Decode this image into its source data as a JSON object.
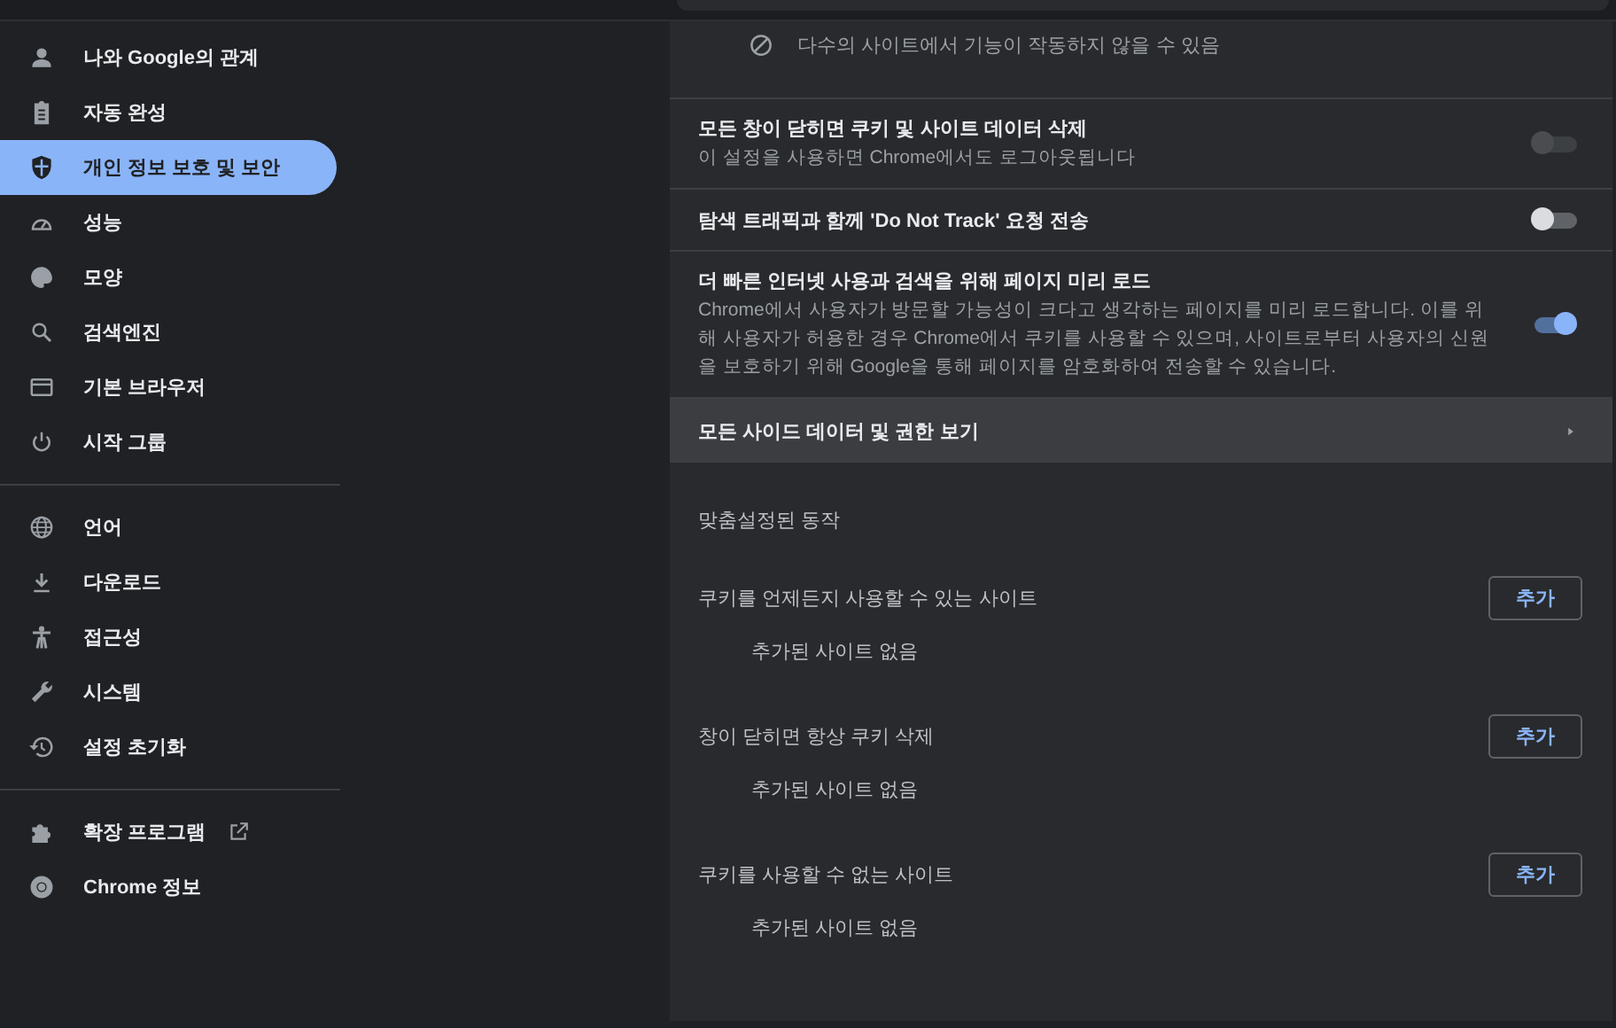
{
  "sidebar": {
    "groups": [
      [
        {
          "label": "나와 Google의 관계",
          "selected": false,
          "external": false
        },
        {
          "label": "자동 완성",
          "selected": false,
          "external": false
        },
        {
          "label": "개인 정보 보호 및 보안",
          "selected": true,
          "external": false
        },
        {
          "label": "성능",
          "selected": false,
          "external": false
        },
        {
          "label": "모양",
          "selected": false,
          "external": false
        },
        {
          "label": "검색엔진",
          "selected": false,
          "external": false
        },
        {
          "label": "기본 브라우저",
          "selected": false,
          "external": false
        },
        {
          "label": "시작 그룹",
          "selected": false,
          "external": false
        }
      ],
      [
        {
          "label": "언어",
          "selected": false,
          "external": false
        },
        {
          "label": "다운로드",
          "selected": false,
          "external": false
        },
        {
          "label": "접근성",
          "selected": false,
          "external": false
        },
        {
          "label": "시스템",
          "selected": false,
          "external": false
        },
        {
          "label": "설정 초기화",
          "selected": false,
          "external": false
        }
      ],
      [
        {
          "label": "확장 프로그램",
          "selected": false,
          "external": true
        },
        {
          "label": "Chrome 정보",
          "selected": false,
          "external": false
        }
      ]
    ]
  },
  "blocked_note": {
    "text": "다수의 사이트에서 기능이 작동하지 않을 수 있음"
  },
  "settings": [
    {
      "title": "모든 창이 닫히면 쿠키 및 사이트 데이터 삭제",
      "description": "이 설정을 사용하면 Chrome에서도 로그아웃됩니다",
      "on": false,
      "disabled": true
    },
    {
      "title": "탐색 트래픽과 함께 'Do Not Track' 요청 전송",
      "on": false,
      "disabled": false
    },
    {
      "title": "더 빠른 인터넷 사용과 검색을 위해 페이지 미리 로드",
      "description": "Chrome에서 사용자가 방문할 가능성이 크다고 생각하는 페이지를 미리 로드합니다. 이를 위해 사용자가 허용한 경우 Chrome에서 쿠키를 사용할 수 있으며, 사이트로부터 사용자의 신원을 보호하기 위해 Google을 통해 페이지를 암호화하여 전송할 수 있습니다.",
      "on": true,
      "disabled": false
    }
  ],
  "link_row": {
    "label": "모든 사이드 데이터 및 권한 보기",
    "highlighted": true
  },
  "custom_behaviors": {
    "heading": "맞춤설정된 동작",
    "lists": [
      {
        "title": "쿠키를 언제든지 사용할 수 있는 사이트",
        "button": "추가",
        "empty_text": "추가된 사이트 없음"
      },
      {
        "title": "창이 닫히면 항상 쿠키 삭제",
        "button": "추가",
        "empty_text": "추가된 사이트 없음"
      },
      {
        "title": "쿠키를 사용할 수 없는 사이트",
        "button": "추가",
        "empty_text": "추가된 사이트 없음"
      }
    ]
  }
}
